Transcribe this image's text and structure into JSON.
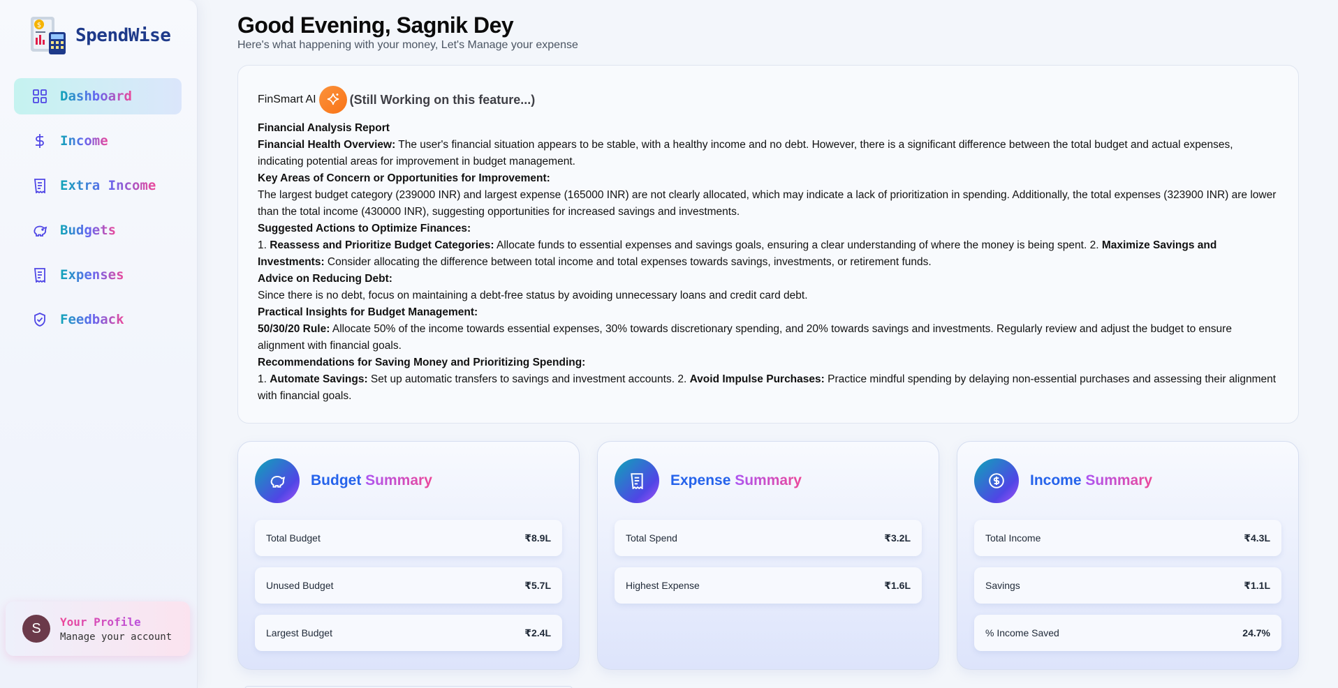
{
  "app": {
    "name": "SpendWise"
  },
  "sidebar": {
    "items": [
      {
        "label": "Dashboard",
        "icon": "grid-icon"
      },
      {
        "label": "Income",
        "icon": "dollar-icon"
      },
      {
        "label": "Extra Income",
        "icon": "receipt-icon"
      },
      {
        "label": "Budgets",
        "icon": "piggy-bank-icon"
      },
      {
        "label": "Expenses",
        "icon": "receipt-icon"
      },
      {
        "label": "Feedback",
        "icon": "shield-check-icon"
      }
    ],
    "active": "Dashboard"
  },
  "profile": {
    "initial": "S",
    "title": "Your Profile",
    "subtitle": "Manage your account"
  },
  "header": {
    "greeting": "Good Evening, Sagnik Dey",
    "subtitle": "Here's what happening with your money, Let's Manage your expense"
  },
  "ai": {
    "name": "FinSmart AI",
    "status": "(Still Working on this feature...)",
    "report_title": "Financial Analysis Report",
    "health_label": "Financial Health Overview:",
    "health_text": " The user's financial situation appears to be stable, with a healthy income and no debt. However, there is a significant difference between the total budget and actual expenses, indicating potential areas for improvement in budget management.",
    "concern_title": "Key Areas of Concern or Opportunities for Improvement:",
    "concern_text": "The largest budget category (239000 INR) and largest expense (165000 INR) are not clearly allocated, which may indicate a lack of prioritization in spending. Additionally, the total expenses (323900 INR) are lower than the total income (430000 INR), suggesting opportunities for increased savings and investments.",
    "actions_title": "Suggested Actions to Optimize Finances:",
    "action_prefix": "1. ",
    "action1_label": "Reassess and Prioritize Budget Categories:",
    "action1_text": " Allocate funds to essential expenses and savings goals, ensuring a clear understanding of where the money is being spent. 2. ",
    "action2_label": "Maximize Savings and Investments:",
    "action2_text": " Consider allocating the difference between total income and total expenses towards savings, investments, or retirement funds.",
    "debt_title": "Advice on Reducing Debt:",
    "debt_text": "Since there is no debt, focus on maintaining a debt-free status by avoiding unnecessary loans and credit card debt.",
    "insights_title": "Practical Insights for Budget Management:",
    "rule_label": "50/30/20 Rule:",
    "rule_text": " Allocate 50% of the income towards essential expenses, 30% towards discretionary spending, and 20% towards savings and investments. Regularly review and adjust the budget to ensure alignment with financial goals.",
    "saving_title": "Recommendations for Saving Money and Prioritizing Spending:",
    "saving_prefix": "1. ",
    "saving1_label": "Automate Savings:",
    "saving1_text": " Set up automatic transfers to savings and investment accounts. 2. ",
    "saving2_label": "Avoid Impulse Purchases:",
    "saving2_text": " Practice mindful spending by delaying non-essential purchases and assessing their alignment with financial goals."
  },
  "budget_summary": {
    "title_1": "Budget",
    "title_2": " Summary",
    "rows": [
      {
        "label": "Total Budget",
        "value": "₹8.9L"
      },
      {
        "label": "Unused Budget",
        "value": "₹5.7L"
      },
      {
        "label": "Largest Budget",
        "value": "₹2.4L"
      }
    ]
  },
  "expense_summary": {
    "title_1": "Expense",
    "title_2": " Summary",
    "rows": [
      {
        "label": "Total Spend",
        "value": "₹3.2L"
      },
      {
        "label": "Highest Expense",
        "value": "₹1.6L"
      }
    ]
  },
  "income_summary": {
    "title_1": "Income",
    "title_2": " Summary",
    "rows": [
      {
        "label": "Total Income",
        "value": "₹4.3L"
      },
      {
        "label": "Savings",
        "value": "₹1.1L"
      },
      {
        "label": "% Income Saved",
        "value": "24.7%"
      }
    ]
  }
}
